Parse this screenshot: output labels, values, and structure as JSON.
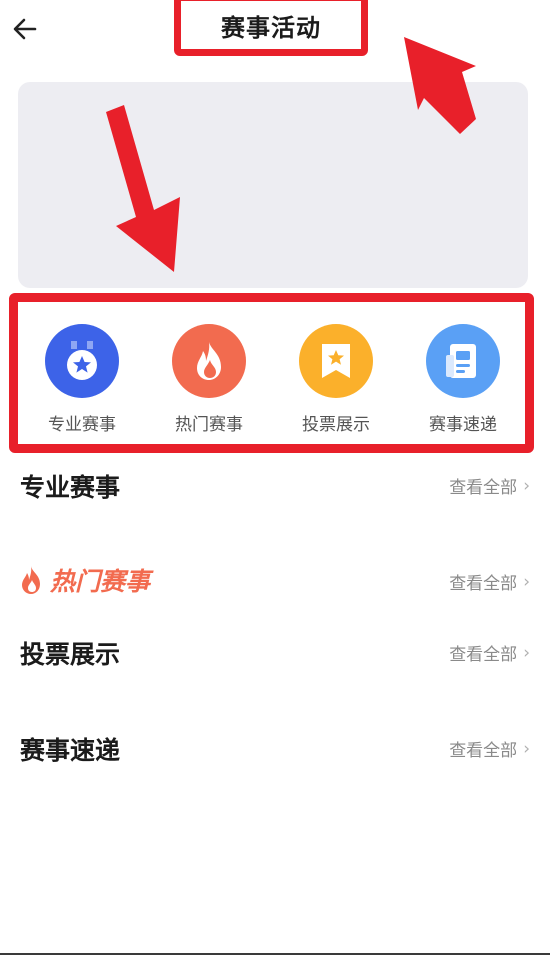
{
  "header": {
    "title": "赛事活动",
    "back_icon": "arrow-left-icon"
  },
  "categories": [
    {
      "label": "专业赛事",
      "icon": "medal-star-icon",
      "color": "#3d63e8"
    },
    {
      "label": "热门赛事",
      "icon": "flame-icon",
      "color": "#f26b4f"
    },
    {
      "label": "投票展示",
      "icon": "bookmark-star-icon",
      "color": "#fbb02b"
    },
    {
      "label": "赛事速递",
      "icon": "news-icon",
      "color": "#5aa0f5"
    }
  ],
  "sections": [
    {
      "title": "专业赛事",
      "more": "查看全部"
    },
    {
      "title": "热门赛事",
      "more": "查看全部"
    },
    {
      "title": "投票展示",
      "more": "查看全部"
    },
    {
      "title": "赛事速递",
      "more": "查看全部"
    }
  ],
  "colors": {
    "annotation": "#e8202a",
    "banner": "#ededf2"
  }
}
